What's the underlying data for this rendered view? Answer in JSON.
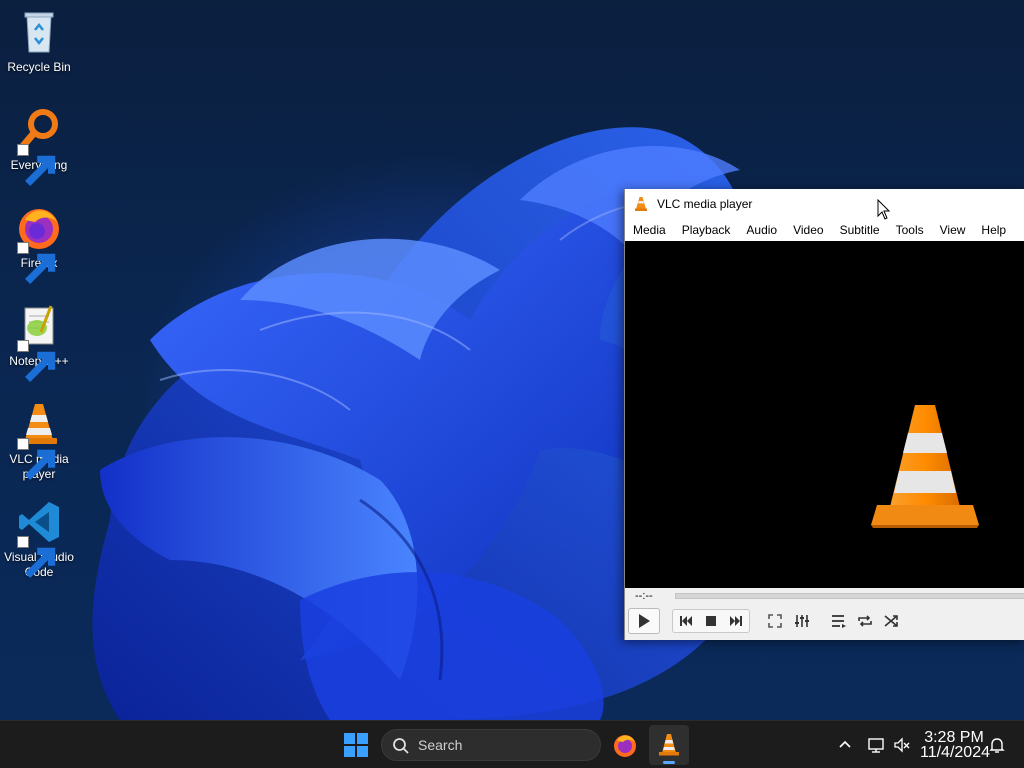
{
  "desktop": {
    "icons": [
      {
        "label": "Recycle Bin",
        "icon": "recycle-bin-icon"
      },
      {
        "label": "Everything",
        "icon": "everything-search-icon"
      },
      {
        "label": "Firefox",
        "icon": "firefox-icon"
      },
      {
        "label": "Notepad++",
        "icon": "notepad-plus-plus-icon"
      },
      {
        "label": "VLC media player",
        "icon": "vlc-cone-icon"
      },
      {
        "label": "Visual Studio Code",
        "icon": "vscode-icon"
      }
    ]
  },
  "vlc": {
    "title": "VLC media player",
    "menu": [
      "Media",
      "Playback",
      "Audio",
      "Video",
      "Subtitle",
      "Tools",
      "View",
      "Help"
    ],
    "time": "--:--",
    "controls": [
      "play",
      "previous",
      "stop",
      "next",
      "fullscreen",
      "extended-settings",
      "playlist",
      "loop",
      "shuffle"
    ]
  },
  "taskbar": {
    "search_placeholder": "Search",
    "pinned": [
      "start",
      "firefox",
      "vlc"
    ],
    "active_app": "vlc",
    "clock": {
      "time": "3:28 PM",
      "date": "11/4/2024"
    }
  },
  "colors": {
    "taskbar_bg": "#1c1c1c",
    "vlc_orange": "#f28c13",
    "accent_indicator": "#58a8ff",
    "wallpaper_blue": "#1f4dff"
  }
}
